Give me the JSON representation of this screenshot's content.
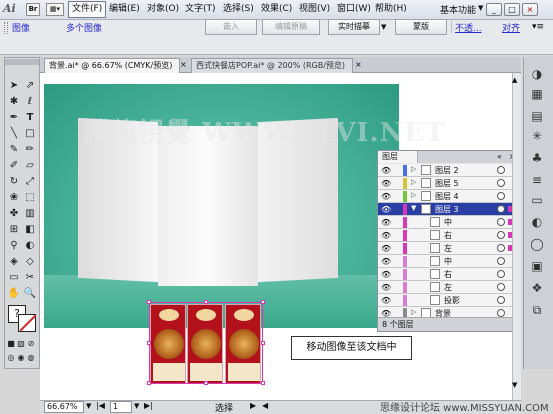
{
  "menubar": {
    "app_logo": "Ai",
    "bridge_logo": "Br",
    "menus": [
      "文件(F)",
      "编辑(E)",
      "对象(O)",
      "文字(T)",
      "选择(S)",
      "效果(C)",
      "视图(V)",
      "窗口(W)",
      "帮助(H)"
    ],
    "workspace": "基本功能",
    "window_buttons": [
      "_",
      "□",
      "×"
    ]
  },
  "controlbar": {
    "label_image": "图像",
    "label_multiple": "多个图像",
    "btn_embed": "嵌入",
    "btn_edit_original": "编辑原稿",
    "btn_live_trace": "实时描摹",
    "btn_mask": "蒙版",
    "link_opacity": "不透...",
    "link_align": "对齐"
  },
  "doc_tabs": [
    {
      "label": "背景.ai* @ 66.67% (CMYK/预览)",
      "active": true
    },
    {
      "label": "西式快餐店POP.ai* @ 200% (RGB/预览)",
      "active": false
    }
  ],
  "canvas": {
    "watermark": "騰龍視覺 WWW.TLVI.NET",
    "callout": "移动图像至该文档中"
  },
  "layers_panel": {
    "tab": "图层",
    "rows": [
      {
        "name": "图层 2",
        "color": "#4b6ee0",
        "selected": false,
        "indent": 0
      },
      {
        "name": "图层 5",
        "color": "#d6c33a",
        "selected": false,
        "indent": 0
      },
      {
        "name": "图层 4",
        "color": "#7ac43a",
        "selected": false,
        "indent": 0
      },
      {
        "name": "图层 3",
        "color": "#d638b7",
        "selected": true,
        "indent": 0
      },
      {
        "name": "中",
        "color": "#d638b7",
        "selected": false,
        "indent": 1
      },
      {
        "name": "右",
        "color": "#d638b7",
        "selected": false,
        "indent": 1
      },
      {
        "name": "左",
        "color": "#d638b7",
        "selected": false,
        "indent": 1
      },
      {
        "name": "中",
        "color": "#d97dd0",
        "selected": false,
        "indent": 1
      },
      {
        "name": "右",
        "color": "#d97dd0",
        "selected": false,
        "indent": 1
      },
      {
        "name": "左",
        "color": "#d97dd0",
        "selected": false,
        "indent": 1
      },
      {
        "name": "投影",
        "color": "#d97dd0",
        "selected": false,
        "indent": 1
      },
      {
        "name": "背景",
        "color": "#8a8a8a",
        "selected": false,
        "indent": 0
      }
    ],
    "footer": "8 个图层"
  },
  "statusbar": {
    "zoom": "66.67%",
    "page": "1",
    "mode": "选择",
    "watermark": "思缘设计论坛 www.MISSYUAN.COM"
  }
}
